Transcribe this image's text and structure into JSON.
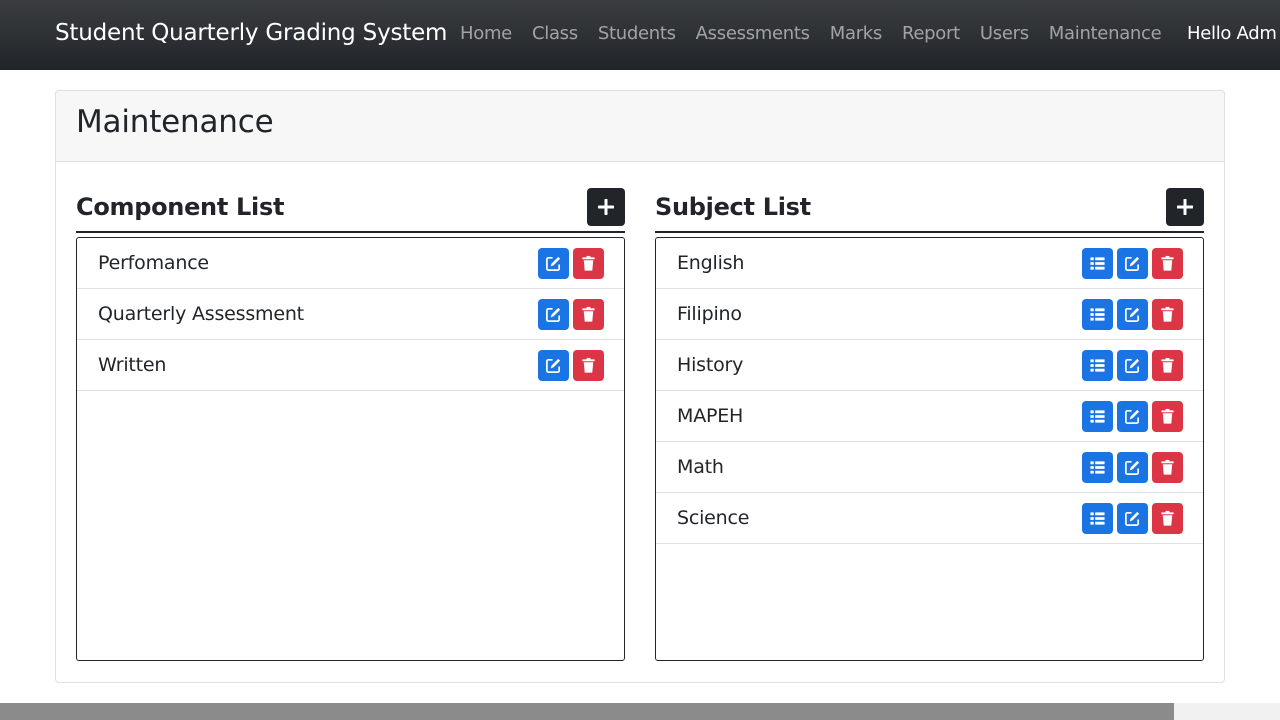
{
  "navbar": {
    "brand": "Student Quarterly Grading System",
    "items": [
      {
        "label": "Home"
      },
      {
        "label": "Class"
      },
      {
        "label": "Students"
      },
      {
        "label": "Assessments"
      },
      {
        "label": "Marks"
      },
      {
        "label": "Report"
      },
      {
        "label": "Users"
      },
      {
        "label": "Maintenance"
      }
    ],
    "greeting": "Hello Adm"
  },
  "page": {
    "title": "Maintenance"
  },
  "component_list": {
    "title": "Component List",
    "add_icon": "plus-icon",
    "items": [
      {
        "label": "Perfomance"
      },
      {
        "label": "Quarterly Assessment"
      },
      {
        "label": "Written"
      }
    ]
  },
  "subject_list": {
    "title": "Subject List",
    "add_icon": "plus-icon",
    "items": [
      {
        "label": "English"
      },
      {
        "label": "Filipino"
      },
      {
        "label": "History"
      },
      {
        "label": "MAPEH"
      },
      {
        "label": "Math"
      },
      {
        "label": "Science"
      }
    ]
  },
  "icons": {
    "list": "list-icon",
    "edit": "edit-icon",
    "delete": "trash-icon"
  },
  "colors": {
    "navbar": "#212529",
    "primary": "#1b74e4",
    "danger": "#dc3545",
    "dark": "#212529"
  }
}
